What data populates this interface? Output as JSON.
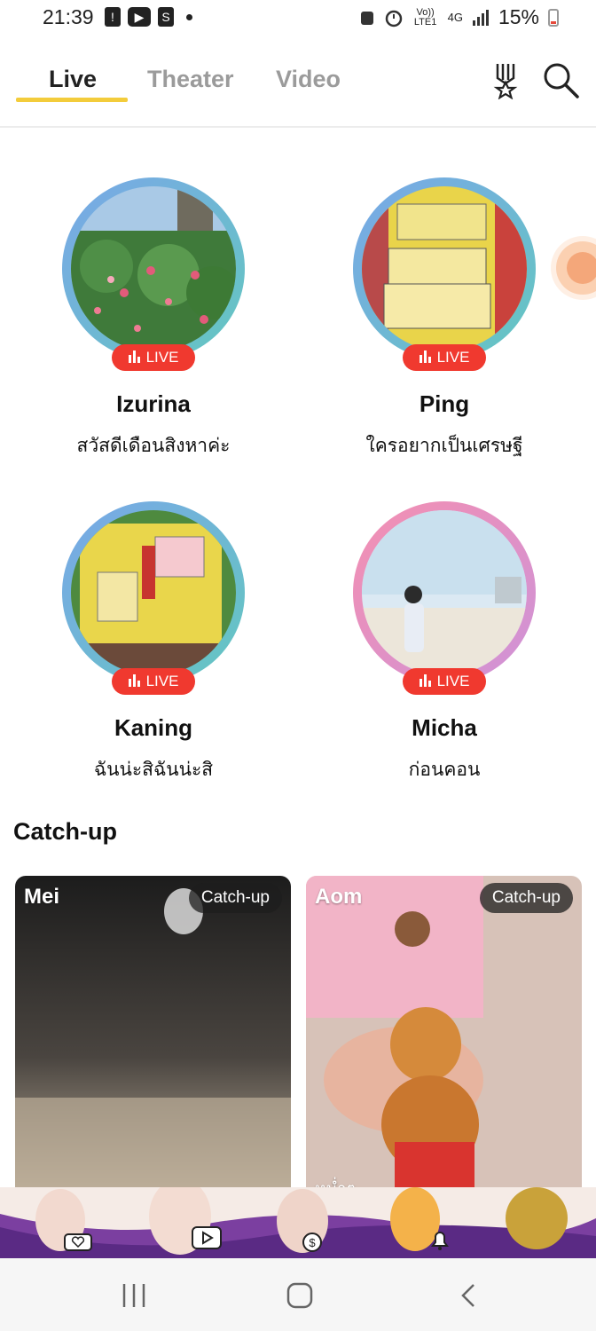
{
  "status_bar": {
    "time": "21:39",
    "battery_percent": "15%",
    "network": "4G",
    "volte": "Vo)) LTE1",
    "icons": [
      "alert-icon",
      "youtube-icon",
      "shopping-icon",
      "dot-icon",
      "recycle-icon",
      "alarm-icon",
      "signal-icon",
      "battery-icon"
    ]
  },
  "top_nav": {
    "tabs": [
      {
        "label": "Live",
        "active": true
      },
      {
        "label": "Theater",
        "active": false
      },
      {
        "label": "Video",
        "active": false
      }
    ],
    "icons": [
      "medal-icon",
      "search-icon"
    ]
  },
  "live": {
    "badge": "LIVE",
    "cards": [
      {
        "name": "Izurina",
        "message": "สวัสดีเดือนสิงหาค่ะ"
      },
      {
        "name": "Ping",
        "message": "ใครอยากเป็นเศรษฐี"
      },
      {
        "name": "Kaning",
        "message": "ฉันน่ะสิฉันน่ะสิ"
      },
      {
        "name": "Micha",
        "message": "ก่อนคอน"
      }
    ]
  },
  "catchup": {
    "title": "Catch-up",
    "badge": "Catch-up",
    "cards": [
      {
        "name": "Mei"
      },
      {
        "name": "Aom",
        "caption": "หม่ำๆ"
      }
    ]
  },
  "colors": {
    "accent_tab": "#f3cc3b",
    "live_badge": "#f0392f",
    "ring_blue": "#7aa7e8",
    "ring_pink": "#f48fb1"
  },
  "system_nav": {
    "icons": [
      "recent-apps-icon",
      "home-icon",
      "back-icon"
    ]
  }
}
